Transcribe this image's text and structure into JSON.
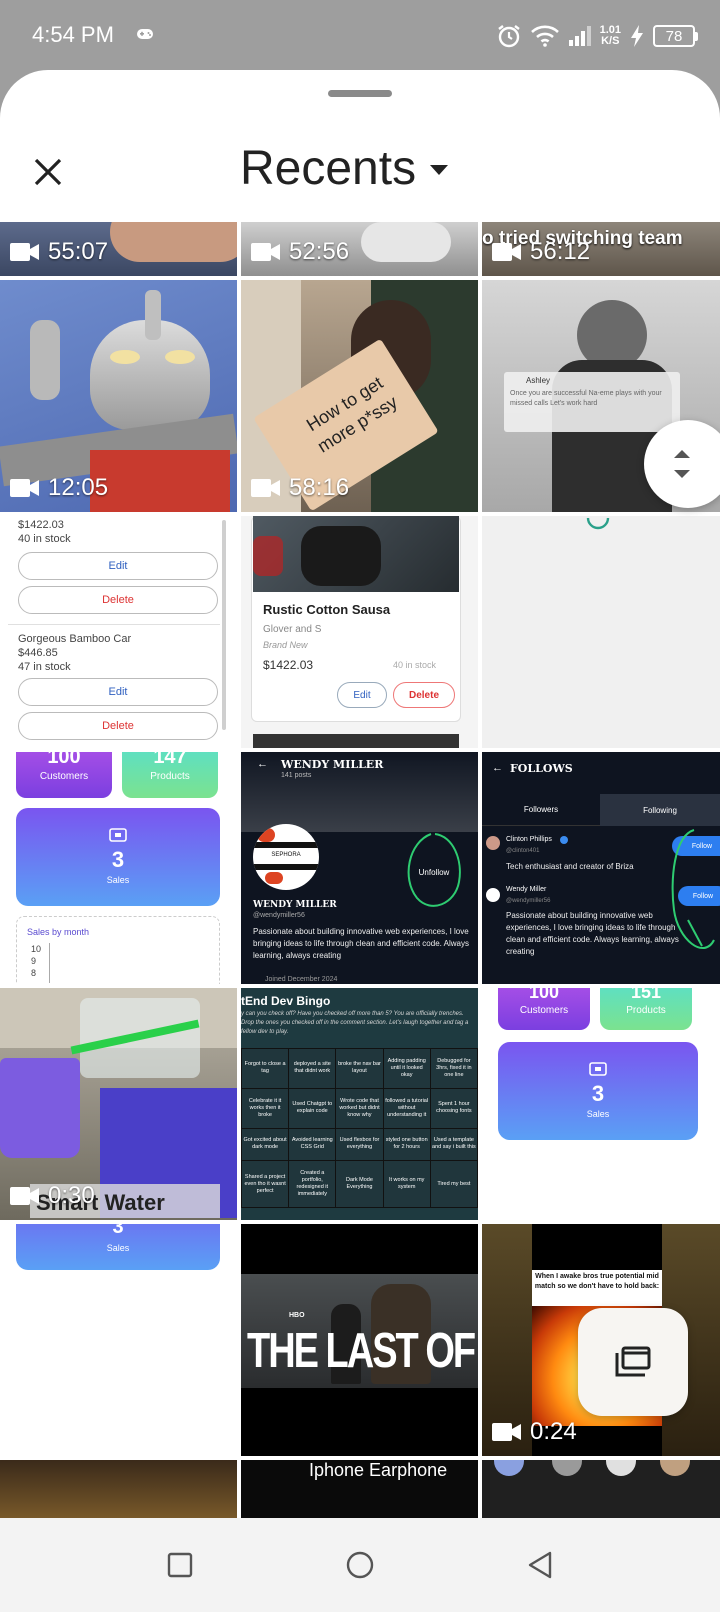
{
  "status_bar": {
    "time": "4:54 PM",
    "speed_value": "1.01",
    "speed_unit": "K/S",
    "battery": "78"
  },
  "header": {
    "title": "Recents"
  },
  "tiles": {
    "t1": {
      "duration": "55:07"
    },
    "t2": {
      "duration": "52:56"
    },
    "t3": {
      "duration": "56:12",
      "caption": "o tried switching team"
    },
    "t4": {
      "duration": "12:05"
    },
    "t5": {
      "duration": "58:16",
      "sign": "How to get more p*ssy"
    },
    "t6": {
      "card_name": "Ashley",
      "card_text": "Once you are successful Na-eme plays with your missed calls Let's work hard"
    },
    "t7": {
      "row1": {
        "price": "$1422.03",
        "stock": "40 in stock"
      },
      "row2": {
        "name": "Gorgeous Bamboo Car",
        "price": "$446.85",
        "stock": "47 in stock"
      },
      "edit": "Edit",
      "delete": "Delete"
    },
    "t8": {
      "name": "Rustic Cotton Sausa",
      "vendor": "Glover and S",
      "condition": "Brand New",
      "price": "$1422.03",
      "stock": "40 in stock",
      "edit": "Edit",
      "delete": "Delete"
    },
    "t10": {
      "customers_value": "100",
      "customers_label": "Customers",
      "products_value": "147",
      "products_label": "Products",
      "sales_value": "3",
      "sales_label": "Sales",
      "chart_title": "Sales by month",
      "y_ticks": [
        "10",
        "9",
        "8"
      ]
    },
    "t11": {
      "name": "WENDY MILLER",
      "posts": "141 posts",
      "brand": "SEPHORA",
      "unfollow": "Unfollow",
      "handle": "@wendymiller56",
      "bio": "Passionate about building innovative web experiences, I love bringing ideas to life through clean and efficient code. Always learning, always creating",
      "joined": "Joined December 2024"
    },
    "t12": {
      "title": "FOLLOWS",
      "tab1": "Followers",
      "tab2": "Following",
      "u1": {
        "name": "Clinton Phillips",
        "handle": "@clinton401",
        "bio": "Tech enthusiast and creator of Briza"
      },
      "u2": {
        "name": "Wendy Miller",
        "handle": "@wendymiller56",
        "bio": "Passionate about building innovative web experiences, I love bringing ideas to life through clean and efficient code. Always learning, always creating"
      },
      "follow": "Follow"
    },
    "t13": {
      "duration": "0:30",
      "caption": "Smart Water"
    },
    "t14": {
      "title": "tEnd Dev Bingo",
      "intro": "y can you check off? Have you checked off more than 5? You are officially trenches. Drop the ones you checked off in the comment section. Let's laugh together and tag a fellow dev to play.",
      "cells": [
        "Forgot to close a tag",
        "deployed a site that didnt work",
        "broke the nav bar layout",
        "Adding padding until it looked okay",
        "Debugged for 3hrs, fixed it in one line",
        "Celebrate it it works then it broke",
        "Used Chatgpt to explain code",
        "Wrote code that worked but didnt know why",
        "followed a tutorial without understanding it",
        "Spent 1 hour choosing fonts",
        "Got excited about dark mode",
        "Avoided learning CSS Grid",
        "Used flexbox for everything",
        "styled one button for 2 hours",
        "Used a template and say i built this",
        "Shared a project even tho it wasnt perfect",
        "Created a portfolio, redesigned it immediately",
        "Dark Mode Everything",
        "It works on my system",
        "Tired my best"
      ]
    },
    "t15": {
      "customers_value": "100",
      "customers_label": "Customers",
      "products_value": "151",
      "products_label": "Products",
      "sales_value": "3",
      "sales_label": "Sales"
    },
    "t16": {
      "sales_value": "3",
      "sales_label": "Sales"
    },
    "t17": {
      "network": "HBO",
      "title": "THE LAST OF US"
    },
    "t18": {
      "duration": "0:24",
      "caption": "When I awake bros true potential mid match so we don't have to hold back:"
    },
    "t20": {
      "caption": "Iphone Earphone"
    }
  }
}
